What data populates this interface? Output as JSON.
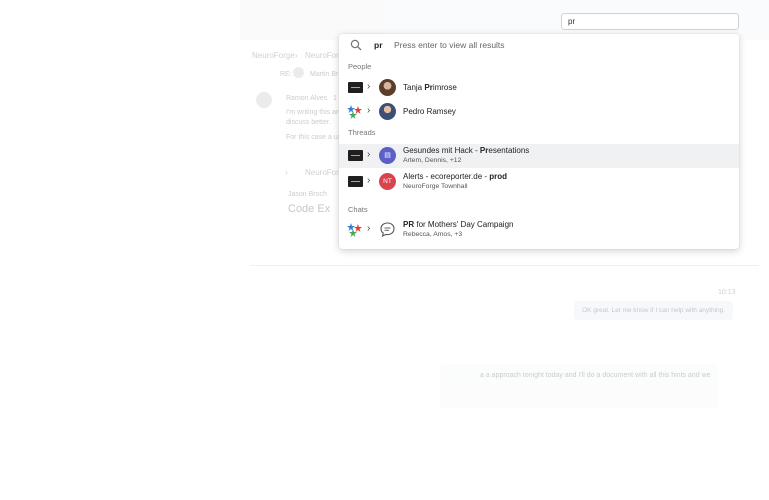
{
  "search": {
    "value": "pr",
    "query": "pr",
    "hint": "Press  enter to view all results"
  },
  "sections": {
    "people": "People",
    "threads": "Threads",
    "chats": "Chats"
  },
  "people": [
    {
      "name_pre": "Tanja ",
      "name_match": "Pr",
      "name_post": "imrose"
    },
    {
      "name_pre": "Pedro Ramsey",
      "name_match": "",
      "name_post": ""
    }
  ],
  "threads": [
    {
      "title_pre": "Gesundes mit Hack - ",
      "title_match": "Pr",
      "title_post": "esentations",
      "subtitle": "Artem, Dennis, +12",
      "icon": "thread-icon"
    },
    {
      "title_pre": "Alerts - ecoreporter.de - ",
      "title_match": "prod",
      "title_post": "",
      "subtitle": "NeuroForge Townhall",
      "initials": "NT"
    }
  ],
  "chats": [
    {
      "title_match": "PR",
      "title_post": " for Mothers' Day Campaign",
      "subtitle": "Rebecca, Amos, +3",
      "icon": "chat-bubble-icon"
    }
  ],
  "background": {
    "crumb1": "NeuroForge",
    "crumb2": "NeuroForge",
    "re_label": "RE:",
    "re_name": "Martin Br",
    "sender": "Ramon Alves",
    "sender_suffix": "1",
    "msg1": "I'm writing this an",
    "msg2": "discuss better.",
    "msg3": "For this case a use",
    "crumb3": "NeuroForge",
    "sender2": "Jason Broch",
    "code_title": "Code Ex",
    "time": "10:13",
    "bubble": "OK great. Let me know if I can help with anything.",
    "compose": "a a approach tonight today and I'll do a document with all this hints and we"
  },
  "colors": {
    "thread_icon": "#5b5fc7",
    "initials_bg": "#d9434e",
    "org_logo": "#1f1f1f"
  }
}
